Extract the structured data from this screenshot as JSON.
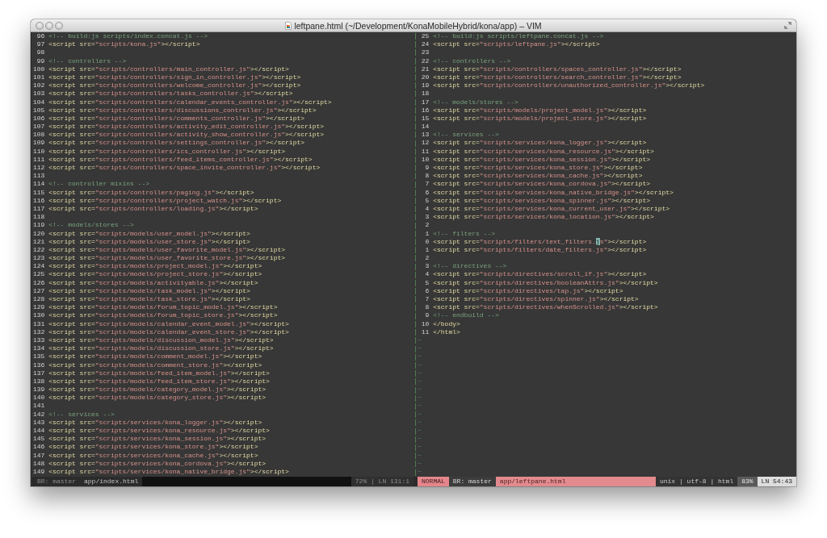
{
  "window": {
    "title": "leftpane.html (~/Development/KonaMobileHybrid/kona/app) – VIM"
  },
  "panes": [
    {
      "active": false,
      "lines": [
        {
          "number": "96",
          "segments": [
            {
              "kind": "comment",
              "text": "<!-- build:js scripts/index.concat.js -->"
            }
          ]
        },
        {
          "number": "97",
          "segments": [
            {
              "kind": "tag",
              "text": "<script src="
            },
            {
              "kind": "string",
              "text": "\"scripts/kona.js\""
            },
            {
              "kind": "tag",
              "text": "></script>"
            }
          ]
        },
        {
          "number": "98"
        },
        {
          "number": "99",
          "segments": [
            {
              "kind": "comment",
              "text": "<!-- controllers -->"
            }
          ]
        },
        {
          "number": "100",
          "segments": [
            {
              "kind": "tag",
              "text": "<script src="
            },
            {
              "kind": "string",
              "text": "\"scripts/controllers/main_controller.js\""
            },
            {
              "kind": "tag",
              "text": "></script>"
            }
          ]
        },
        {
          "number": "101",
          "segments": [
            {
              "kind": "tag",
              "text": "<script src="
            },
            {
              "kind": "string",
              "text": "\"scripts/controllers/sign_in_controller.js\""
            },
            {
              "kind": "tag",
              "text": "></script>"
            }
          ]
        },
        {
          "number": "102",
          "segments": [
            {
              "kind": "tag",
              "text": "<script src="
            },
            {
              "kind": "string",
              "text": "\"scripts/controllers/welcome_controller.js\""
            },
            {
              "kind": "tag",
              "text": "></script>"
            }
          ]
        },
        {
          "number": "103",
          "segments": [
            {
              "kind": "tag",
              "text": "<script src="
            },
            {
              "kind": "string",
              "text": "\"scripts/controllers/tasks_controller.js\""
            },
            {
              "kind": "tag",
              "text": "></script>"
            }
          ]
        },
        {
          "number": "104",
          "segments": [
            {
              "kind": "tag",
              "text": "<script src="
            },
            {
              "kind": "string",
              "text": "\"scripts/controllers/calendar_events_controller.js\""
            },
            {
              "kind": "tag",
              "text": "></script>"
            }
          ]
        },
        {
          "number": "105",
          "segments": [
            {
              "kind": "tag",
              "text": "<script src="
            },
            {
              "kind": "string",
              "text": "\"scripts/controllers/discussions_controller.js\""
            },
            {
              "kind": "tag",
              "text": "></script>"
            }
          ]
        },
        {
          "number": "106",
          "segments": [
            {
              "kind": "tag",
              "text": "<script src="
            },
            {
              "kind": "string",
              "text": "\"scripts/controllers/comments_controller.js\""
            },
            {
              "kind": "tag",
              "text": "></script>"
            }
          ]
        },
        {
          "number": "107",
          "segments": [
            {
              "kind": "tag",
              "text": "<script src="
            },
            {
              "kind": "string",
              "text": "\"scripts/controllers/activity_edit_controller.js\""
            },
            {
              "kind": "tag",
              "text": "></script>"
            }
          ]
        },
        {
          "number": "108",
          "segments": [
            {
              "kind": "tag",
              "text": "<script src="
            },
            {
              "kind": "string",
              "text": "\"scripts/controllers/activity_show_controller.js\""
            },
            {
              "kind": "tag",
              "text": "></script>"
            }
          ]
        },
        {
          "number": "109",
          "segments": [
            {
              "kind": "tag",
              "text": "<script src="
            },
            {
              "kind": "string",
              "text": "\"scripts/controllers/settings_controller.js\""
            },
            {
              "kind": "tag",
              "text": "></script>"
            }
          ]
        },
        {
          "number": "110",
          "segments": [
            {
              "kind": "tag",
              "text": "<script src="
            },
            {
              "kind": "string",
              "text": "\"scripts/controllers/ics_controller.js\""
            },
            {
              "kind": "tag",
              "text": "></script>"
            }
          ]
        },
        {
          "number": "111",
          "segments": [
            {
              "kind": "tag",
              "text": "<script src="
            },
            {
              "kind": "string",
              "text": "\"scripts/controllers/feed_items_controller.js\""
            },
            {
              "kind": "tag",
              "text": "></script>"
            }
          ]
        },
        {
          "number": "112",
          "segments": [
            {
              "kind": "tag",
              "text": "<script src="
            },
            {
              "kind": "string",
              "text": "\"scripts/controllers/space_invite_controller.js\""
            },
            {
              "kind": "tag",
              "text": "></script>"
            }
          ]
        },
        {
          "number": "113"
        },
        {
          "number": "114",
          "segments": [
            {
              "kind": "comment",
              "text": "<!-- controller mixins -->"
            }
          ]
        },
        {
          "number": "115",
          "segments": [
            {
              "kind": "tag",
              "text": "<script src="
            },
            {
              "kind": "string",
              "text": "\"scripts/controllers/paging.js\""
            },
            {
              "kind": "tag",
              "text": "></script>"
            }
          ]
        },
        {
          "number": "116",
          "segments": [
            {
              "kind": "tag",
              "text": "<script src="
            },
            {
              "kind": "string",
              "text": "\"scripts/controllers/project_watch.js\""
            },
            {
              "kind": "tag",
              "text": "></script>"
            }
          ]
        },
        {
          "number": "117",
          "segments": [
            {
              "kind": "tag",
              "text": "<script src="
            },
            {
              "kind": "string",
              "text": "\"scripts/controllers/loading.js\""
            },
            {
              "kind": "tag",
              "text": "></script>"
            }
          ]
        },
        {
          "number": "118"
        },
        {
          "number": "119",
          "segments": [
            {
              "kind": "comment",
              "text": "<!-- models/stores -->"
            }
          ]
        },
        {
          "number": "120",
          "segments": [
            {
              "kind": "tag",
              "text": "<script src="
            },
            {
              "kind": "string",
              "text": "\"scripts/models/user_model.js\""
            },
            {
              "kind": "tag",
              "text": "></script>"
            }
          ]
        },
        {
          "number": "121",
          "segments": [
            {
              "kind": "tag",
              "text": "<script src="
            },
            {
              "kind": "string",
              "text": "\"scripts/models/user_store.js\""
            },
            {
              "kind": "tag",
              "text": "></script>"
            }
          ]
        },
        {
          "number": "122",
          "segments": [
            {
              "kind": "tag",
              "text": "<script src="
            },
            {
              "kind": "string",
              "text": "\"scripts/models/user_favorite_model.js\""
            },
            {
              "kind": "tag",
              "text": "></script>"
            }
          ]
        },
        {
          "number": "123",
          "segments": [
            {
              "kind": "tag",
              "text": "<script src="
            },
            {
              "kind": "string",
              "text": "\"scripts/models/user_favorite_store.js\""
            },
            {
              "kind": "tag",
              "text": "></script>"
            }
          ]
        },
        {
          "number": "124",
          "segments": [
            {
              "kind": "tag",
              "text": "<script src="
            },
            {
              "kind": "string",
              "text": "\"scripts/models/project_model.js\""
            },
            {
              "kind": "tag",
              "text": "></script>"
            }
          ]
        },
        {
          "number": "125",
          "segments": [
            {
              "kind": "tag",
              "text": "<script src="
            },
            {
              "kind": "string",
              "text": "\"scripts/models/project_store.js\""
            },
            {
              "kind": "tag",
              "text": "></script>"
            }
          ]
        },
        {
          "number": "126",
          "segments": [
            {
              "kind": "tag",
              "text": "<script src="
            },
            {
              "kind": "string",
              "text": "\"scripts/models/activityable.js\""
            },
            {
              "kind": "tag",
              "text": "></script>"
            }
          ]
        },
        {
          "number": "127",
          "segments": [
            {
              "kind": "tag",
              "text": "<script src="
            },
            {
              "kind": "string",
              "text": "\"scripts/models/task_model.js\""
            },
            {
              "kind": "tag",
              "text": "></script>"
            }
          ]
        },
        {
          "number": "128",
          "segments": [
            {
              "kind": "tag",
              "text": "<script src="
            },
            {
              "kind": "string",
              "text": "\"scripts/models/task_store.js\""
            },
            {
              "kind": "tag",
              "text": "></script>"
            }
          ]
        },
        {
          "number": "129",
          "segments": [
            {
              "kind": "tag",
              "text": "<script src="
            },
            {
              "kind": "string",
              "text": "\"scripts/models/forum_topic_model.js\""
            },
            {
              "kind": "tag",
              "text": "></script>"
            }
          ]
        },
        {
          "number": "130",
          "segments": [
            {
              "kind": "tag",
              "text": "<script src="
            },
            {
              "kind": "string",
              "text": "\"scripts/models/forum_topic_store.js\""
            },
            {
              "kind": "tag",
              "text": "></script>"
            }
          ]
        },
        {
          "number": "131",
          "segments": [
            {
              "kind": "tag",
              "text": "<script src="
            },
            {
              "kind": "string",
              "text": "\"scripts/models/calendar_event_model.js\""
            },
            {
              "kind": "tag",
              "text": "></script>"
            }
          ]
        },
        {
          "number": "132",
          "segments": [
            {
              "kind": "tag",
              "text": "<script src="
            },
            {
              "kind": "string",
              "text": "\"scripts/models/calendar_event_store.js\""
            },
            {
              "kind": "tag",
              "text": "></script>"
            }
          ]
        },
        {
          "number": "133",
          "segments": [
            {
              "kind": "tag",
              "text": "<script src="
            },
            {
              "kind": "string",
              "text": "\"scripts/models/discussion_model.js\""
            },
            {
              "kind": "tag",
              "text": "></script>"
            }
          ]
        },
        {
          "number": "134",
          "segments": [
            {
              "kind": "tag",
              "text": "<script src="
            },
            {
              "kind": "string",
              "text": "\"scripts/models/discussion_store.js\""
            },
            {
              "kind": "tag",
              "text": "></script>"
            }
          ]
        },
        {
          "number": "135",
          "segments": [
            {
              "kind": "tag",
              "text": "<script src="
            },
            {
              "kind": "string",
              "text": "\"scripts/models/comment_model.js\""
            },
            {
              "kind": "tag",
              "text": "></script>"
            }
          ]
        },
        {
          "number": "136",
          "segments": [
            {
              "kind": "tag",
              "text": "<script src="
            },
            {
              "kind": "string",
              "text": "\"scripts/models/comment_store.js\""
            },
            {
              "kind": "tag",
              "text": "></script>"
            }
          ]
        },
        {
          "number": "137",
          "segments": [
            {
              "kind": "tag",
              "text": "<script src="
            },
            {
              "kind": "string",
              "text": "\"scripts/models/feed_item_model.js\""
            },
            {
              "kind": "tag",
              "text": "></script>"
            }
          ]
        },
        {
          "number": "138",
          "segments": [
            {
              "kind": "tag",
              "text": "<script src="
            },
            {
              "kind": "string",
              "text": "\"scripts/models/feed_item_store.js\""
            },
            {
              "kind": "tag",
              "text": "></script>"
            }
          ]
        },
        {
          "number": "139",
          "segments": [
            {
              "kind": "tag",
              "text": "<script src="
            },
            {
              "kind": "string",
              "text": "\"scripts/models/category_model.js\""
            },
            {
              "kind": "tag",
              "text": "></script>"
            }
          ]
        },
        {
          "number": "140",
          "segments": [
            {
              "kind": "tag",
              "text": "<script src="
            },
            {
              "kind": "string",
              "text": "\"scripts/models/category_store.js\""
            },
            {
              "kind": "tag",
              "text": "></script>"
            }
          ]
        },
        {
          "number": "141"
        },
        {
          "number": "142",
          "segments": [
            {
              "kind": "comment",
              "text": "<!-- services -->"
            }
          ]
        },
        {
          "number": "143",
          "segments": [
            {
              "kind": "tag",
              "text": "<script src="
            },
            {
              "kind": "string",
              "text": "\"scripts/services/kona_logger.js\""
            },
            {
              "kind": "tag",
              "text": "></script>"
            }
          ]
        },
        {
          "number": "144",
          "segments": [
            {
              "kind": "tag",
              "text": "<script src="
            },
            {
              "kind": "string",
              "text": "\"scripts/services/kona_resource.js\""
            },
            {
              "kind": "tag",
              "text": "></script>"
            }
          ]
        },
        {
          "number": "145",
          "segments": [
            {
              "kind": "tag",
              "text": "<script src="
            },
            {
              "kind": "string",
              "text": "\"scripts/services/kona_session.js\""
            },
            {
              "kind": "tag",
              "text": "></script>"
            }
          ]
        },
        {
          "number": "146",
          "segments": [
            {
              "kind": "tag",
              "text": "<script src="
            },
            {
              "kind": "string",
              "text": "\"scripts/services/kona_store.js\""
            },
            {
              "kind": "tag",
              "text": "></script>"
            }
          ]
        },
        {
          "number": "147",
          "segments": [
            {
              "kind": "tag",
              "text": "<script src="
            },
            {
              "kind": "string",
              "text": "\"scripts/services/kona_cache.js\""
            },
            {
              "kind": "tag",
              "text": "></script>"
            }
          ]
        },
        {
          "number": "148",
          "segments": [
            {
              "kind": "tag",
              "text": "<script src="
            },
            {
              "kind": "string",
              "text": "\"scripts/services/kona_cordova.js\""
            },
            {
              "kind": "tag",
              "text": "></script>"
            }
          ]
        },
        {
          "number": "149",
          "segments": [
            {
              "kind": "tag",
              "text": "<script src="
            },
            {
              "kind": "string",
              "text": "\"scripts/services/kona_native_bridge.js\""
            },
            {
              "kind": "tag",
              "text": "></script>"
            }
          ]
        }
      ],
      "status_bar": [
        {
          "kind": "branch",
          "text": "BR: master"
        },
        {
          "kind": "file",
          "text": "app/index.html"
        },
        {
          "kind": "gap"
        },
        {
          "kind": "position",
          "text": "72% | LN 131:1"
        }
      ]
    },
    {
      "active": true,
      "lines": [
        {
          "number": "25",
          "segments": [
            {
              "kind": "comment",
              "text": "<!-- build:js scripts/leftpane.concat.js -->"
            }
          ]
        },
        {
          "number": "24",
          "segments": [
            {
              "kind": "tag",
              "text": "<script src="
            },
            {
              "kind": "string",
              "text": "\"scripts/leftpane.js\""
            },
            {
              "kind": "tag",
              "text": "></script>"
            }
          ]
        },
        {
          "number": "23"
        },
        {
          "number": "22",
          "segments": [
            {
              "kind": "comment",
              "text": "<!-- controllers -->"
            }
          ]
        },
        {
          "number": "21",
          "segments": [
            {
              "kind": "tag",
              "text": "<script src="
            },
            {
              "kind": "string",
              "text": "\"scripts/controllers/spaces_controller.js\""
            },
            {
              "kind": "tag",
              "text": "></script>"
            }
          ]
        },
        {
          "number": "20",
          "segments": [
            {
              "kind": "tag",
              "text": "<script src="
            },
            {
              "kind": "string",
              "text": "\"scripts/controllers/search_controller.js\""
            },
            {
              "kind": "tag",
              "text": "></script>"
            }
          ]
        },
        {
          "number": "19",
          "segments": [
            {
              "kind": "tag",
              "text": "<script src="
            },
            {
              "kind": "string",
              "text": "\"scripts/controllers/unauthorized_controller.js\""
            },
            {
              "kind": "tag",
              "text": "></script>"
            }
          ]
        },
        {
          "number": "18"
        },
        {
          "number": "17",
          "segments": [
            {
              "kind": "comment",
              "text": "<!-- models/stores -->"
            }
          ]
        },
        {
          "number": "16",
          "segments": [
            {
              "kind": "tag",
              "text": "<script src="
            },
            {
              "kind": "string",
              "text": "\"scripts/models/project_model.js\""
            },
            {
              "kind": "tag",
              "text": "></script>"
            }
          ]
        },
        {
          "number": "15",
          "segments": [
            {
              "kind": "tag",
              "text": "<script src="
            },
            {
              "kind": "string",
              "text": "\"scripts/models/project_store.js\""
            },
            {
              "kind": "tag",
              "text": "></script>"
            }
          ]
        },
        {
          "number": "14"
        },
        {
          "number": "13",
          "segments": [
            {
              "kind": "comment",
              "text": "<!-- services -->"
            }
          ]
        },
        {
          "number": "12",
          "segments": [
            {
              "kind": "tag",
              "text": "<script src="
            },
            {
              "kind": "string",
              "text": "\"scripts/services/kona_logger.js\""
            },
            {
              "kind": "tag",
              "text": "></script>"
            }
          ]
        },
        {
          "number": "11",
          "segments": [
            {
              "kind": "tag",
              "text": "<script src="
            },
            {
              "kind": "string",
              "text": "\"scripts/services/kona_resource.js\""
            },
            {
              "kind": "tag",
              "text": "></script>"
            }
          ]
        },
        {
          "number": "10",
          "segments": [
            {
              "kind": "tag",
              "text": "<script src="
            },
            {
              "kind": "string",
              "text": "\"scripts/services/kona_session.js\""
            },
            {
              "kind": "tag",
              "text": "></script>"
            }
          ]
        },
        {
          "number": "9",
          "segments": [
            {
              "kind": "tag",
              "text": "<script src="
            },
            {
              "kind": "string",
              "text": "\"scripts/services/kona_store.js\""
            },
            {
              "kind": "tag",
              "text": "></script>"
            }
          ]
        },
        {
          "number": "8",
          "segments": [
            {
              "kind": "tag",
              "text": "<script src="
            },
            {
              "kind": "string",
              "text": "\"scripts/services/kona_cache.js\""
            },
            {
              "kind": "tag",
              "text": "></script>"
            }
          ]
        },
        {
          "number": "7",
          "segments": [
            {
              "kind": "tag",
              "text": "<script src="
            },
            {
              "kind": "string",
              "text": "\"scripts/services/kona_cordova.js\""
            },
            {
              "kind": "tag",
              "text": "></script>"
            }
          ]
        },
        {
          "number": "6",
          "segments": [
            {
              "kind": "tag",
              "text": "<script src="
            },
            {
              "kind": "string",
              "text": "\"scripts/services/kona_native_bridge.js\""
            },
            {
              "kind": "tag",
              "text": "></script>"
            }
          ]
        },
        {
          "number": "5",
          "segments": [
            {
              "kind": "tag",
              "text": "<script src="
            },
            {
              "kind": "string",
              "text": "\"scripts/services/kona_spinner.js\""
            },
            {
              "kind": "tag",
              "text": "></script>"
            }
          ]
        },
        {
          "number": "4",
          "segments": [
            {
              "kind": "tag",
              "text": "<script src="
            },
            {
              "kind": "string",
              "text": "\"scripts/services/kona_current_user.js\""
            },
            {
              "kind": "tag",
              "text": "></script>"
            }
          ]
        },
        {
          "number": "3",
          "segments": [
            {
              "kind": "tag",
              "text": "<script src="
            },
            {
              "kind": "string",
              "text": "\"scripts/services/kona_location.js\""
            },
            {
              "kind": "tag",
              "text": "></script>"
            }
          ]
        },
        {
          "number": "2"
        },
        {
          "number": "1",
          "segments": [
            {
              "kind": "comment",
              "text": "<!-- filters -->"
            }
          ]
        },
        {
          "number": "0",
          "segments": [
            {
              "kind": "tag",
              "text": "<script src="
            },
            {
              "kind": "string",
              "text": "\"scripts/filters/text_filters."
            },
            {
              "kind": "cursor",
              "text": "j"
            },
            {
              "kind": "string",
              "text": "s\""
            },
            {
              "kind": "tag",
              "text": "></script>"
            }
          ]
        },
        {
          "number": "1",
          "segments": [
            {
              "kind": "tag",
              "text": "<script src="
            },
            {
              "kind": "string",
              "text": "\"scripts/filters/date_filters.js\""
            },
            {
              "kind": "tag",
              "text": "></script>"
            }
          ]
        },
        {
          "number": "2"
        },
        {
          "number": "3",
          "segments": [
            {
              "kind": "comment",
              "text": "<!-- directives -->"
            }
          ]
        },
        {
          "number": "4",
          "segments": [
            {
              "kind": "tag",
              "text": "<script src="
            },
            {
              "kind": "string",
              "text": "\"scripts/directives/scroll_if.js\""
            },
            {
              "kind": "tag",
              "text": "></script>"
            }
          ]
        },
        {
          "number": "5",
          "segments": [
            {
              "kind": "tag",
              "text": "<script src="
            },
            {
              "kind": "string",
              "text": "\"scripts/directives/booleanAttrs.js\""
            },
            {
              "kind": "tag",
              "text": "></script>"
            }
          ]
        },
        {
          "number": "6",
          "segments": [
            {
              "kind": "tag",
              "text": "<script src="
            },
            {
              "kind": "string",
              "text": "\"scripts/directives/tap.js\""
            },
            {
              "kind": "tag",
              "text": "></script>"
            }
          ]
        },
        {
          "number": "7",
          "segments": [
            {
              "kind": "tag",
              "text": "<script src="
            },
            {
              "kind": "string",
              "text": "\"scripts/directives/spinner.js\""
            },
            {
              "kind": "tag",
              "text": "></script>"
            }
          ]
        },
        {
          "number": "8",
          "segments": [
            {
              "kind": "tag",
              "text": "<script src="
            },
            {
              "kind": "string",
              "text": "\"scripts/directives/whenScrolled.js\""
            },
            {
              "kind": "tag",
              "text": "></script>"
            }
          ]
        },
        {
          "number": "9",
          "segments": [
            {
              "kind": "comment",
              "text": "<!-- endbuild -->"
            }
          ]
        },
        {
          "number": "10",
          "segments": [
            {
              "kind": "tag",
              "text": "</body>"
            }
          ]
        },
        {
          "number": "11",
          "segments": [
            {
              "kind": "tag",
              "text": "</html>"
            }
          ]
        }
      ],
      "empty_line_markers": [
        "~",
        "~",
        "~",
        "~",
        "~",
        "~",
        "~",
        "~",
        "~",
        "~",
        "~",
        "~",
        "~",
        "~",
        "~",
        "~",
        "~"
      ],
      "status_bar": [
        {
          "kind": "mode",
          "text": "NORMAL"
        },
        {
          "kind": "branch",
          "text": "BR: master"
        },
        {
          "kind": "file",
          "text": "app/leftpane.html"
        },
        {
          "kind": "info",
          "text": "unix | utf-8 | html"
        },
        {
          "kind": "percent",
          "text": "83%"
        },
        {
          "kind": "position",
          "text": "LN 54:43"
        }
      ]
    }
  ]
}
